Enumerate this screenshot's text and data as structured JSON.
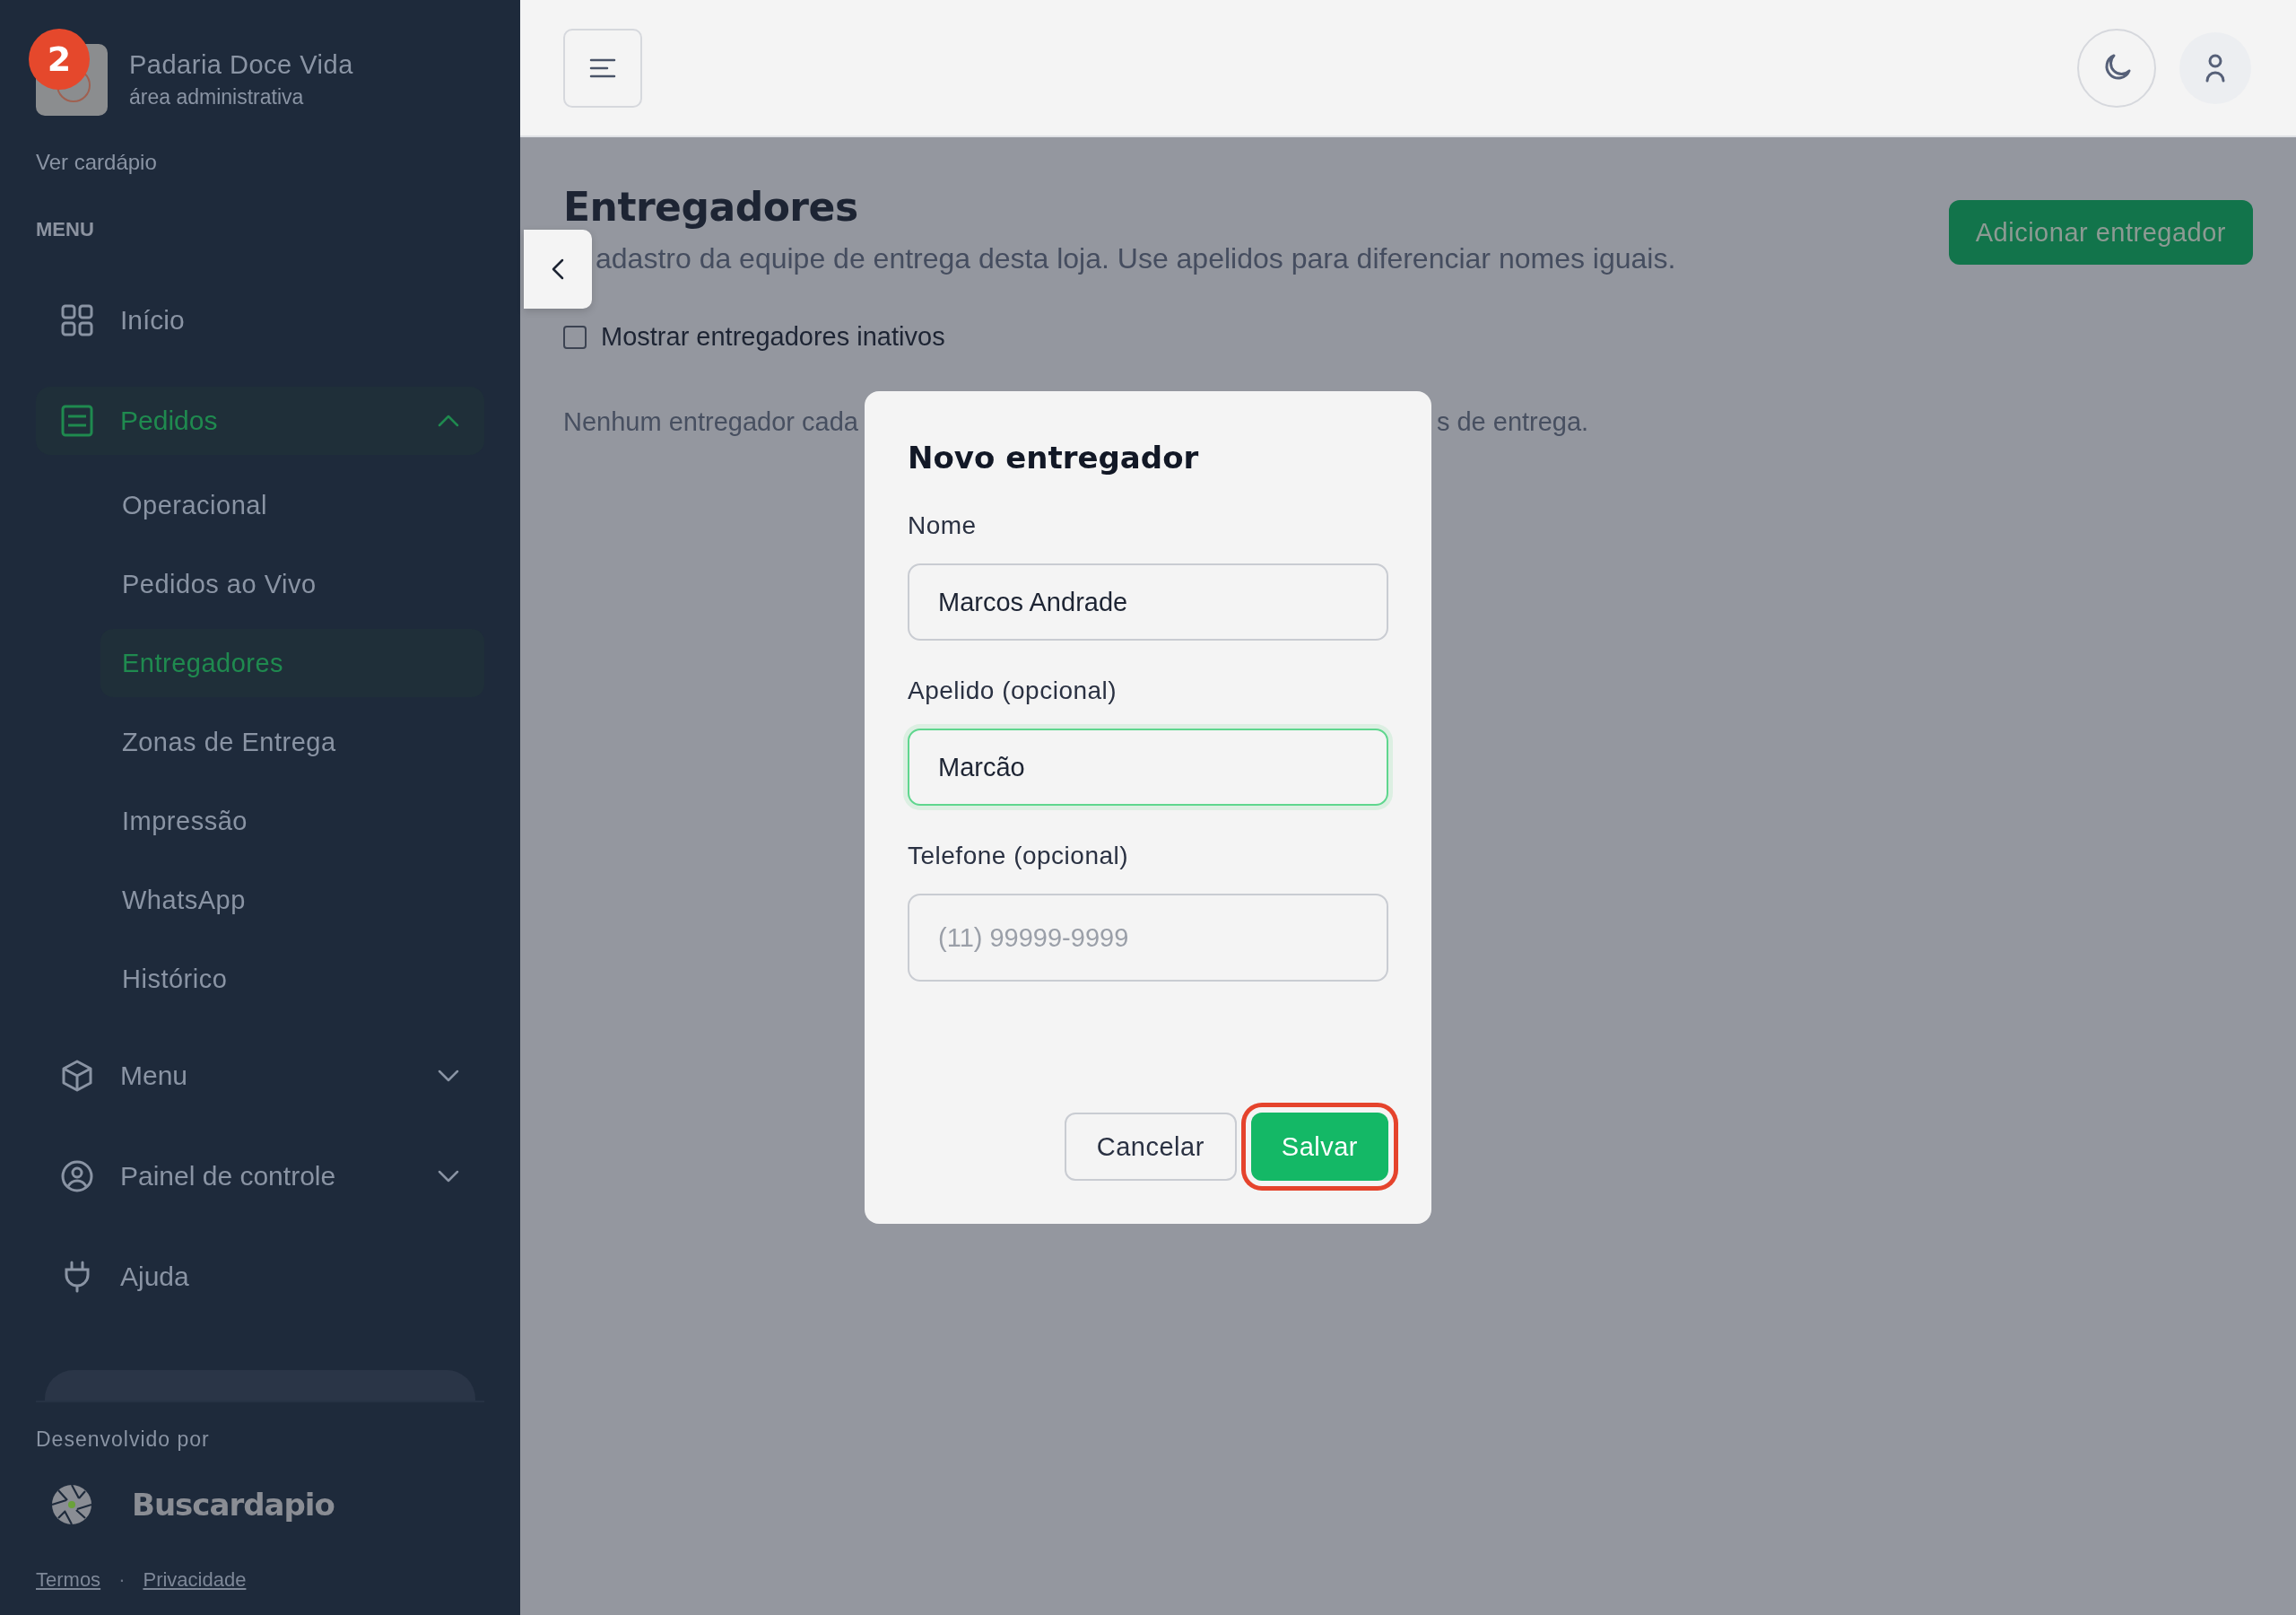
{
  "sidebar": {
    "badge": "2",
    "store_name": "Padaria Doce Vida",
    "store_subtitle": "área administrativa",
    "menu_link": "Ver cardápio",
    "section_label": "MENU",
    "items": [
      {
        "label": "Início",
        "kind": "grid",
        "selected": false
      },
      {
        "label": "Pedidos",
        "kind": "list",
        "selected": true,
        "expanded": true,
        "children": [
          {
            "label": "Operacional",
            "selected": false
          },
          {
            "label": "Pedidos ao Vivo",
            "selected": false
          },
          {
            "label": "Entregadores",
            "selected": true
          },
          {
            "label": "Zonas de Entrega",
            "selected": false
          },
          {
            "label": "Impressão",
            "selected": false
          },
          {
            "label": "WhatsApp",
            "selected": false
          },
          {
            "label": "Histórico",
            "selected": false
          }
        ]
      },
      {
        "label": "Menu",
        "kind": "box",
        "selected": false,
        "expanded": false
      },
      {
        "label": "Painel de controle",
        "kind": "account",
        "selected": false,
        "expanded": false
      },
      {
        "label": "Ajuda",
        "kind": "plug",
        "selected": false
      }
    ],
    "footer": {
      "developed_by": "Desenvolvido por",
      "brand": "Buscardapio",
      "links": [
        "Termos",
        "Privacidade"
      ],
      "link_separator": "·"
    }
  },
  "page": {
    "title": "Entregadores",
    "subtitle": "adastro da equipe de entrega desta loja. Use apelidos para diferenciar nomes iguais.",
    "add_button": "Adicionar entregador",
    "show_inactive": {
      "label": "Mostrar entregadores inativos",
      "checked": false
    },
    "empty_message": [
      "Nenhum entregador cada",
      "s de entrega."
    ]
  },
  "modal": {
    "title": "Novo entregador",
    "fields": [
      {
        "label": "Nome",
        "value": "Marcos Andrade",
        "focused": false
      },
      {
        "label": "Apelido (opcional)",
        "value": "Marcão",
        "focused": true
      },
      {
        "label": "Telefone (opcional)",
        "placeholder": "(11) 99999-9999",
        "focused": false
      }
    ],
    "buttons": [
      {
        "label": "Cancelar",
        "kind": "secondary",
        "highlighted": false
      },
      {
        "label": "Salvar",
        "kind": "primary",
        "highlighted": true
      }
    ]
  }
}
